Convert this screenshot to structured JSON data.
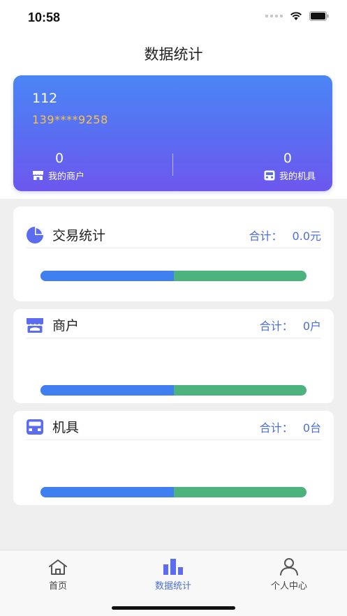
{
  "status_bar": {
    "time": "10:58"
  },
  "nav": {
    "title": "数据统计"
  },
  "summary": {
    "name": "112",
    "phone": "139****9258",
    "merchants": {
      "value": "0",
      "label": "我的商户"
    },
    "machines": {
      "value": "0",
      "label": "我的机具"
    }
  },
  "panels": {
    "transactions": {
      "title": "交易统计",
      "total_label": "合计：",
      "total_value": "0.0元",
      "progress": 0.5
    },
    "merchants": {
      "title": "商户",
      "total_label": "合计：",
      "total_value": "0户",
      "progress": 0.5
    },
    "machines": {
      "title": "机具",
      "total_label": "合计：",
      "total_value": "0台",
      "progress": 0.5
    }
  },
  "tabbar": {
    "home": "首页",
    "stats": "数据统计",
    "profile": "个人中心"
  },
  "colors": {
    "accent": "#4a6ee0",
    "progress_blue": "#3f7ff0",
    "progress_green": "#4db37e",
    "phone": "#f7c34a"
  }
}
